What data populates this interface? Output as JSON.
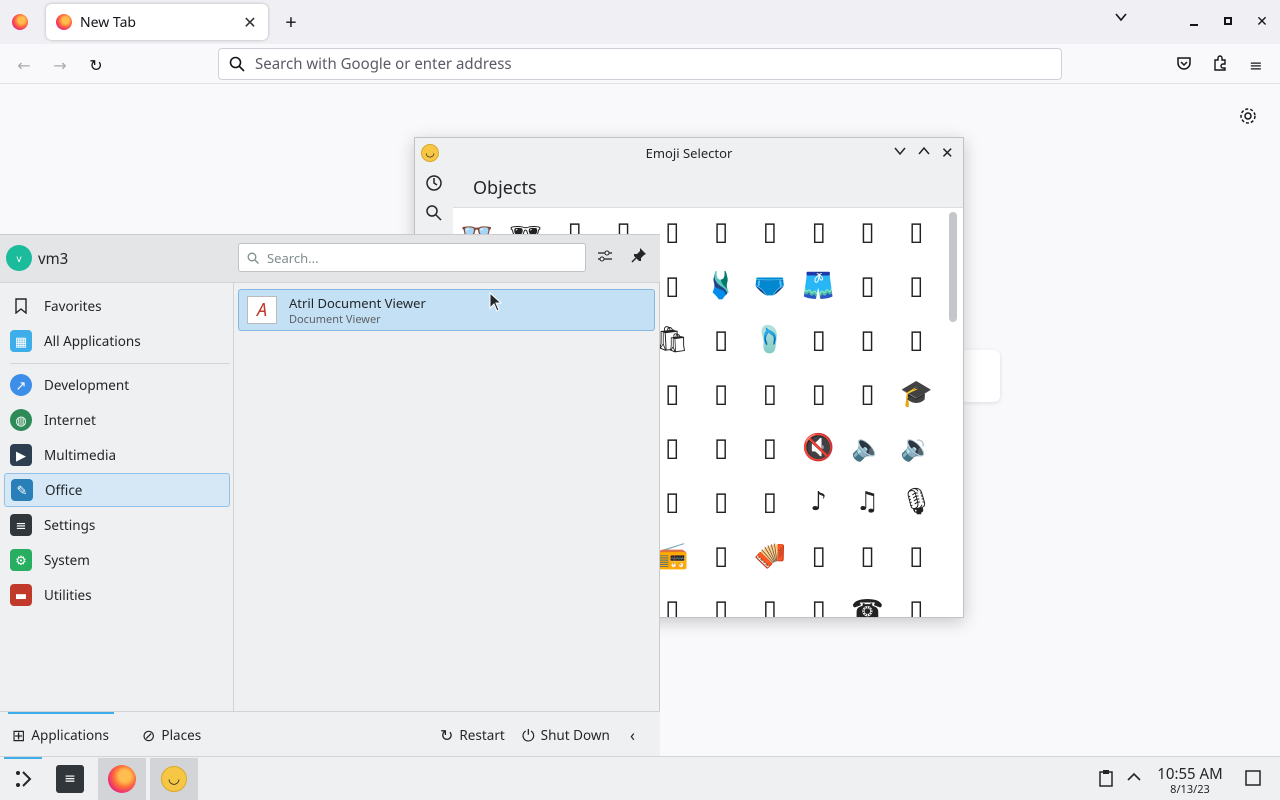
{
  "browser": {
    "tab_title": "New Tab",
    "address_placeholder": "Search with Google or enter address"
  },
  "emoji_selector": {
    "window_title": "Emoji Selector",
    "category_title": "Objects",
    "rows": [
      [
        "👓",
        "🕶",
        "🥽",
        "🥼",
        "🦺",
        "👔",
        "👕",
        "👖",
        "🧣",
        "🧤"
      ],
      [
        "🧥",
        "🧦",
        "👗",
        "👘",
        "🥻",
        "🩱",
        "🩲",
        "🩳",
        "👙",
        "👚"
      ],
      [
        "👛",
        "👜",
        "👝",
        "🛍",
        "🎒",
        "🩴",
        "👞",
        "👟",
        "🥾",
        "🥿"
      ],
      [
        "👠",
        "👡",
        "🩰",
        "👢",
        "👑",
        "👒",
        "🎩",
        "🎓",
        "🧢",
        "🪖"
      ],
      [
        "⛑",
        "📿",
        "💄",
        "💍",
        "💎",
        "🔇",
        "🔈",
        "🔉",
        "🔊",
        "📢"
      ],
      [
        "📣",
        "📯",
        "🔔",
        "🔕",
        "🎼",
        "🎵",
        "🎶",
        "🎙",
        "🎚",
        "🎛"
      ],
      [
        "🎤",
        "🎧",
        "📻",
        "🎷",
        "🪗",
        "🎸",
        "🎹",
        "🎺",
        "🎻",
        "🪕"
      ],
      [
        "🥁",
        "🪘",
        "📱",
        "📲",
        "☎",
        "📞",
        "📟",
        "📠",
        "🔋",
        "🔌"
      ]
    ],
    "rendered_cells": {
      "r0c0": "👓",
      "r0c1": "🕶",
      "r1c5": "🩱",
      "r1c6": "🩲",
      "r1c7": "🩳",
      "r2c4": "🛍",
      "r2c6": "🩴",
      "r3c9": "🎓",
      "r4c7": "🔇",
      "r4c8": "🔈",
      "r4c9": "🔉",
      "r5c7": "♪",
      "r5c8": "♫",
      "r5c9": "🎙",
      "r6c4": "📻",
      "r6c6": "🪗",
      "r7c8": "☎"
    }
  },
  "launcher": {
    "username": "vm3",
    "avatar_letter": "v",
    "search_placeholder": "Search...",
    "categories": [
      {
        "label": "Favorites",
        "color": "#232629"
      },
      {
        "label": "All Applications",
        "color": "#3daee9"
      },
      {
        "label": "Development",
        "color": "#3d8ee9"
      },
      {
        "label": "Internet",
        "color": "#2e8b57"
      },
      {
        "label": "Multimedia",
        "color": "#2c3e50"
      },
      {
        "label": "Office",
        "color": "#2980b9"
      },
      {
        "label": "Settings",
        "color": "#31363b"
      },
      {
        "label": "System",
        "color": "#27ae60"
      },
      {
        "label": "Utilities",
        "color": "#c0392b"
      }
    ],
    "selected_category": "Office",
    "result": {
      "name": "Atril Document Viewer",
      "description": "Document Viewer"
    },
    "footer": {
      "applications": "Applications",
      "places": "Places",
      "restart": "Restart",
      "shutdown": "Shut Down"
    }
  },
  "taskbar": {
    "time": "10:55 AM",
    "date": "8/13/23"
  }
}
